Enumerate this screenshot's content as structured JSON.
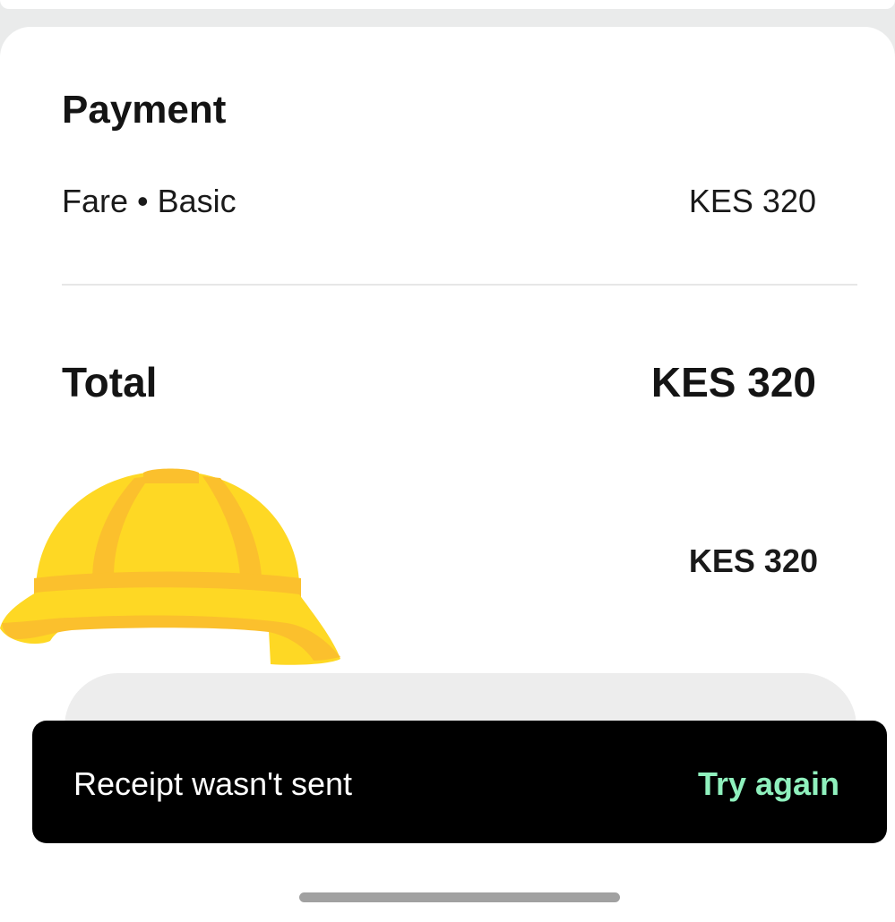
{
  "payment": {
    "title": "Payment",
    "fare_label": "Fare • Basic",
    "fare_amount": "KES 320"
  },
  "total": {
    "label": "Total",
    "amount": "KES 320"
  },
  "paid": {
    "amount": "KES 320"
  },
  "toast": {
    "message": "Receipt wasn't sent",
    "action": "Try again",
    "action_color": "#8ff0bd"
  },
  "overlay_sticker": "hard-hat"
}
